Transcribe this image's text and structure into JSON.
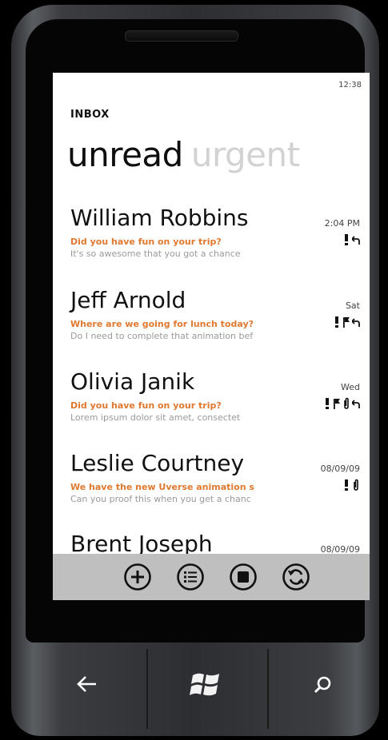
{
  "status": {
    "time": "12:38"
  },
  "header": {
    "section": "INBOX",
    "pivot_active": "unread",
    "pivot_inactive": "urgent"
  },
  "messages": [
    {
      "sender": "William Robbins",
      "subject": "Did you have fun on your trip?",
      "preview": "It's so awesome that you got a chance",
      "date": "2:04 PM",
      "flags": [
        "urgent",
        "reply"
      ]
    },
    {
      "sender": "Jeff Arnold",
      "subject": "Where are we going for lunch today?",
      "preview": "Do I need to complete that animation bef",
      "date": "Sat",
      "flags": [
        "urgent",
        "flag",
        "reply"
      ]
    },
    {
      "sender": "Olivia Janik",
      "subject": "Did you have fun on your trip?",
      "preview": "Lorem ipsum dolor sit amet, consectet",
      "date": "Wed",
      "flags": [
        "urgent",
        "flag",
        "attachment",
        "reply"
      ]
    },
    {
      "sender": "Leslie Courtney",
      "subject": "We have the new Uverse animation s",
      "preview": "Can you proof this when you get a chanc",
      "date": "08/09/09",
      "flags": [
        "urgent",
        "attachment"
      ]
    },
    {
      "sender": "Brent Joseph",
      "subject": "",
      "preview": "",
      "date": "08/09/09",
      "flags": []
    }
  ],
  "appbar": {
    "buttons": [
      "new-icon",
      "list-icon",
      "stop-icon",
      "sync-icon"
    ]
  },
  "hardware": {
    "buttons": [
      "back-icon",
      "windows-logo-icon",
      "search-icon"
    ]
  },
  "colors": {
    "accent": "#e0792f",
    "appbar": "#bfbfbf",
    "pivot_inactive": "#d2d2d2"
  }
}
